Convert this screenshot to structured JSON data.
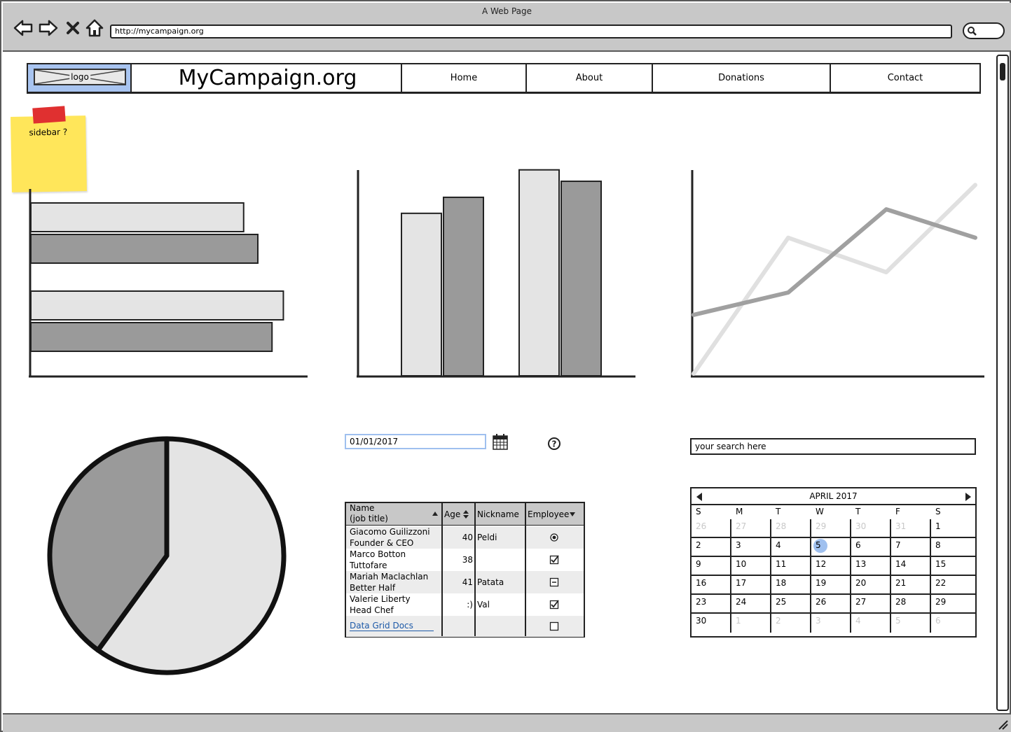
{
  "browser": {
    "window_title": "A Web Page",
    "url": "http://mycampaign.org"
  },
  "header": {
    "logo_label": "logo",
    "site_title": "MyCampaign.org",
    "nav": [
      {
        "label": "Home"
      },
      {
        "label": "About"
      },
      {
        "label": "Donations"
      },
      {
        "label": "Contact"
      }
    ]
  },
  "sticky_note": {
    "text": "sidebar ?"
  },
  "date_picker": {
    "value": "01/01/2017"
  },
  "search": {
    "placeholder": "your search here"
  },
  "data_grid": {
    "headers": {
      "name": "Name\n(job title)",
      "age": "Age",
      "nickname": "Nickname",
      "employee": "Employee"
    },
    "rows": [
      {
        "name": "Giacomo Guilizzoni",
        "title": "Founder & CEO",
        "age": "40",
        "nickname": "Peldi",
        "employee": "radio"
      },
      {
        "name": "Marco Botton",
        "title": "Tuttofare",
        "age": "38",
        "nickname": "",
        "employee": "checked"
      },
      {
        "name": "Mariah Maclachlan",
        "title": "Better Half",
        "age": "41",
        "nickname": "Patata",
        "employee": "indeterminate"
      },
      {
        "name": "Valerie Liberty",
        "title": "Head Chef",
        "age": ":)",
        "nickname": "Val",
        "employee": "checked"
      }
    ],
    "footer_link": "Data Grid Docs",
    "footer_employee": "unchecked"
  },
  "calendar": {
    "month_label": "APRIL 2017",
    "weekdays": [
      "S",
      "M",
      "T",
      "W",
      "T",
      "F",
      "S"
    ],
    "weeks": [
      [
        "26",
        "27",
        "28",
        "29",
        "30",
        "31",
        "1"
      ],
      [
        "2",
        "3",
        "4",
        "5",
        "6",
        "7",
        "8"
      ],
      [
        "9",
        "10",
        "11",
        "12",
        "13",
        "14",
        "15"
      ],
      [
        "16",
        "17",
        "18",
        "19",
        "20",
        "21",
        "22"
      ],
      [
        "23",
        "24",
        "25",
        "26",
        "27",
        "28",
        "29"
      ],
      [
        "30",
        "1",
        "2",
        "3",
        "4",
        "5",
        "6"
      ]
    ],
    "selected_day": "5"
  },
  "colors": {
    "light_series": "#e4e4e4",
    "dark_series": "#9a9a9a",
    "accent_blue": "#9fc0ef",
    "sticky_yellow": "#ffe65a",
    "tape_red": "#e03030",
    "chrome_gray": "#c8c8c8"
  },
  "chart_data": [
    {
      "type": "bar",
      "orientation": "horizontal",
      "categories": [
        "",
        ""
      ],
      "series": [
        {
          "values": [
            0.75,
            0.89
          ]
        },
        {
          "values": [
            0.8,
            0.85
          ]
        }
      ]
    },
    {
      "type": "bar",
      "orientation": "vertical",
      "categories": [
        "",
        ""
      ],
      "series": [
        {
          "values": [
            0.71,
            0.9
          ]
        },
        {
          "values": [
            0.78,
            0.85
          ]
        }
      ]
    },
    {
      "type": "line",
      "x": [
        0,
        1,
        2,
        3
      ],
      "series": [
        {
          "values": [
            0.0,
            0.67,
            0.5,
            0.93
          ]
        },
        {
          "values": [
            0.29,
            0.4,
            0.81,
            0.67
          ]
        }
      ]
    },
    {
      "type": "pie",
      "series": [
        {
          "values": [
            0.6,
            0.4
          ]
        }
      ]
    }
  ]
}
